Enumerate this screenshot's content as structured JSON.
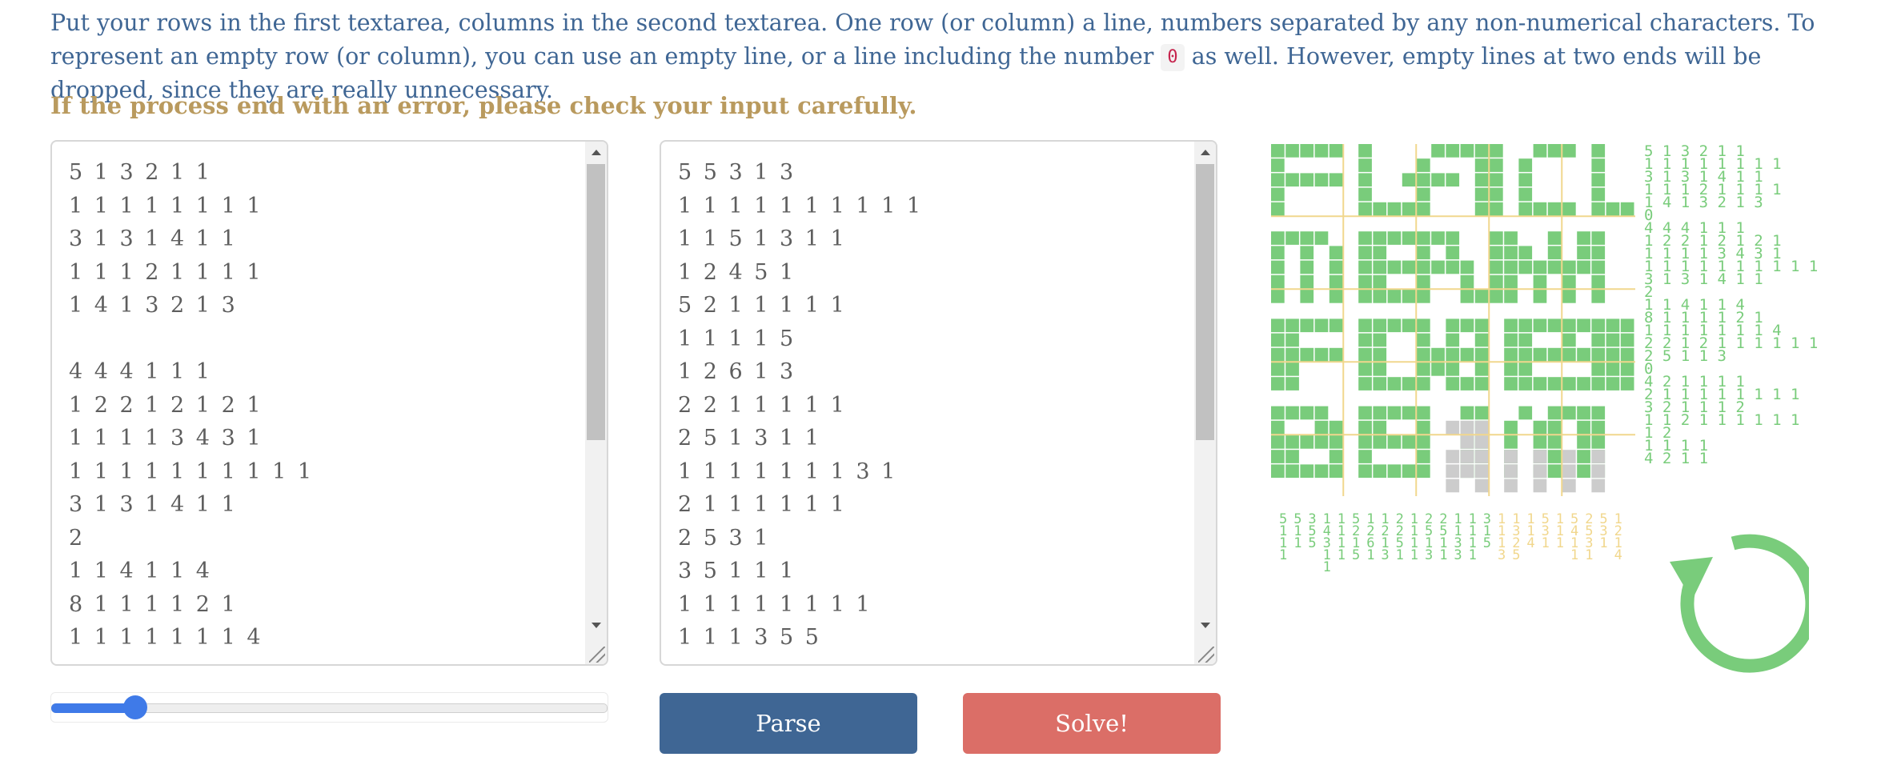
{
  "intro": {
    "part1": "Put your rows in the first textarea, columns in the second textarea. One row (or column) a line, numbers separated by any non-numerical characters. To represent an empty row (or column), you can use an empty line, or a line including the number ",
    "code": "0",
    "part2": " as well. However, empty lines at two ends will be dropped, since they are really unnecessary."
  },
  "warning": "If the process end with an error, please check your input carefully.",
  "rows_text": "5 1 3 2 1 1\n1 1 1 1 1 1 1 1\n3 1 3 1 4 1 1\n1 1 1 2 1 1 1 1\n1 4 1 3 2 1 3\n\n4 4 4 1 1 1\n1 2 2 1 2 1 2 1\n1 1 1 1 3 4 3 1\n1 1 1 1 1 1 1 1 1 1\n3 1 3 1 4 1 1\n2\n1 1 4 1 1 4\n8 1 1 1 1 2 1\n1 1 1 1 1 1 1 4",
  "cols_text": "5 5 3 1 3\n1 1 1 1 1 1 1 1 1 1\n1 1 5 1 3 1 1\n1 2 4 5 1\n5 2 1 1 1 1 1\n1 1 1 1 5\n1 2 6 1 3\n2 2 1 1 1 1 1\n2 5 1 3 1 1\n1 1 1 1 1 1 1 3 1\n2 1 1 1 1 1 1\n2 5 3 1\n3 5 1 1 1\n1 1 1 1 1 1 1 1\n1 1 1 3 5 5",
  "slider": {
    "value_fraction": 0.15
  },
  "buttons": {
    "parse": "Parse",
    "solve": "Solve!"
  },
  "colors": {
    "text_blue": "#3f6694",
    "warning_gold": "#b99a5e",
    "parse_bg": "#3f6694",
    "solve_bg": "#db6e67",
    "cell_filled": "#79cc7b",
    "cell_unknown": "#cccccc",
    "grid_line": "#f1d78d",
    "slider_blue": "#3f7ae8"
  },
  "row_clues_text": "5 1 3 2 1 1\n1 1 1 1 1 1 1 1\n3 1 3 1 4 1 1\n1 1 1 2 1 1 1 1\n1 4 1 3 2 1 3\n0\n4 4 4 1 1 1\n1 2 2 1 2 1 2 1\n1 1 1 1 3 4 3 1\n1 1 1 1 1 1 1 1 1 1\n3 1 3 1 4 1 1\n2\n1 1 4 1 1 4\n8 1 1 1 1 2 1\n1 1 1 1 1 1 1 4\n2 2 1 2 1 1 1 1 1 1\n2 5 1 1 3\n0\n4 2 1 1 1 1\n2 1 1 1 1 1 1 1 1\n3 2 1 1 1 2\n1 1 2 1 1 1 1 1 1\n1 2\n1 1 1 1\n4 2 1 1",
  "col_clues": [
    "5 1 1 1",
    "5 1 1",
    "3 5 5",
    "1 4 3 1 1",
    "1 1 1 1",
    "5 2 1 5",
    "1 2 6 1",
    "1 2 1 3",
    "2 2 5 1",
    "1 1 1 1",
    "2 5 1 3",
    "2 5 1 1",
    "1 1 3 3",
    "1 1 1 1",
    "3 1 5",
    "1 1 1 3",
    "1 3 2 5",
    "1 1 4",
    "5 3 1",
    "1 1 1",
    "5 4 1 1",
    "2 5 3 1",
    "5 3 1",
    "1 2 1 4",
    "1 1 1 1"
  ],
  "refresh_icon": "circular-arrow-refresh-icon"
}
